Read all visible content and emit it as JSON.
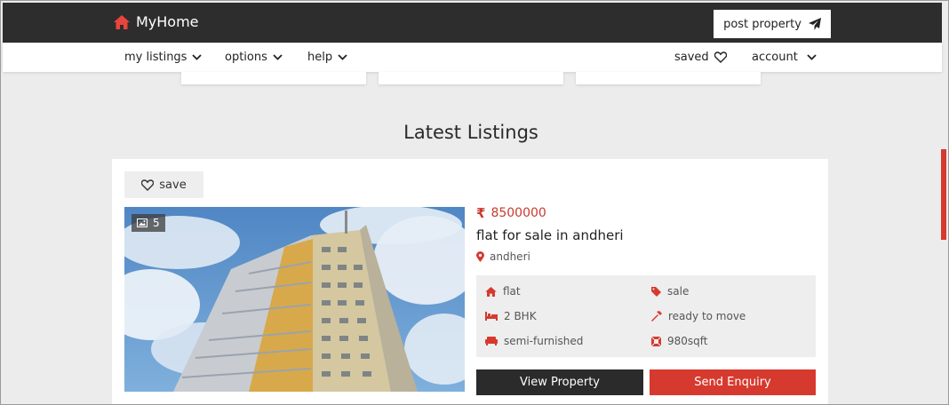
{
  "header": {
    "brand": "MyHome",
    "post_property_label": "post property"
  },
  "subnav": {
    "my_listings": "my listings",
    "options": "options",
    "help": "help",
    "saved": "saved",
    "account": "account"
  },
  "section": {
    "title": "Latest Listings"
  },
  "listing": {
    "save_label": "save",
    "photo_count": "5",
    "price": "8500000",
    "title": "flat for sale in andheri",
    "location": "andheri",
    "features": {
      "type": "flat",
      "purpose": "sale",
      "bhk": "2 BHK",
      "status": "ready to move",
      "furnishing": "semi-furnished",
      "area": "980sqft"
    },
    "view_label": "View Property",
    "enquiry_label": "Send Enquiry"
  },
  "colors": {
    "brand_red": "#d63a2f",
    "dark": "#2d2d2d"
  },
  "icons": {
    "home": "home-icon",
    "send": "paper-plane-icon",
    "chevron": "chevron-down-icon",
    "heart": "heart-icon",
    "image": "image-icon",
    "rupee": "rupee-icon",
    "pin": "map-pin-icon",
    "tag": "tag-icon",
    "bed": "bed-icon",
    "hammer": "hammer-icon",
    "sofa": "sofa-icon",
    "area": "area-icon"
  }
}
